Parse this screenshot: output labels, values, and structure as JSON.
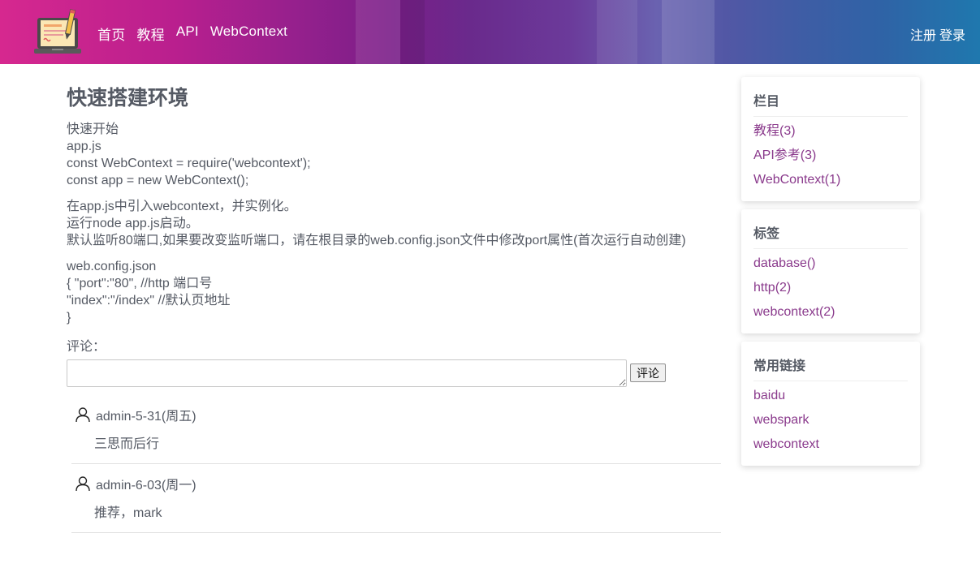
{
  "header": {
    "nav": [
      "首页",
      "教程",
      "API",
      "WebContext"
    ],
    "auth": {
      "register": "注册",
      "login": "登录"
    }
  },
  "article": {
    "title": "快速搭建环境",
    "blocks": [
      [
        "快速开始",
        "app.js",
        "const WebContext = require('webcontext');",
        "const app = new WebContext();"
      ],
      [
        "在app.js中引入webcontext，并实例化。",
        "运行node app.js启动。",
        "默认监听80端口,如果要改变监听端口，请在根目录的web.config.json文件中修改port属性(首次运行自动创建)"
      ],
      [
        "web.config.json",
        "{ \"port\":\"80\", //http 端口号",
        "\"index\":\"/index\" //默认页地址",
        "}"
      ]
    ]
  },
  "comment_form": {
    "label": "评论：",
    "value": "",
    "submit": "评论"
  },
  "comments": [
    {
      "author": "admin-5-31(周五)",
      "text": "三思而后行"
    },
    {
      "author": "admin-6-03(周一)",
      "text": "推荐，mark"
    }
  ],
  "sidebar": {
    "categories": {
      "title": "栏目",
      "items": [
        "教程(3)",
        "API参考(3)",
        "WebContext(1)"
      ]
    },
    "tags": {
      "title": "标签",
      "items": [
        "database()",
        "http(2)",
        "webcontext(2)"
      ]
    },
    "links": {
      "title": "常用链接",
      "items": [
        "baidu",
        "webspark",
        "webcontext"
      ]
    }
  },
  "colors": {
    "link": "#8a3a8c",
    "text": "#555a64",
    "header_left": "#d6288f",
    "header_right": "#1f78ae"
  },
  "icons": {
    "logo": "laptop-notebook-icon",
    "user": "user-icon"
  }
}
